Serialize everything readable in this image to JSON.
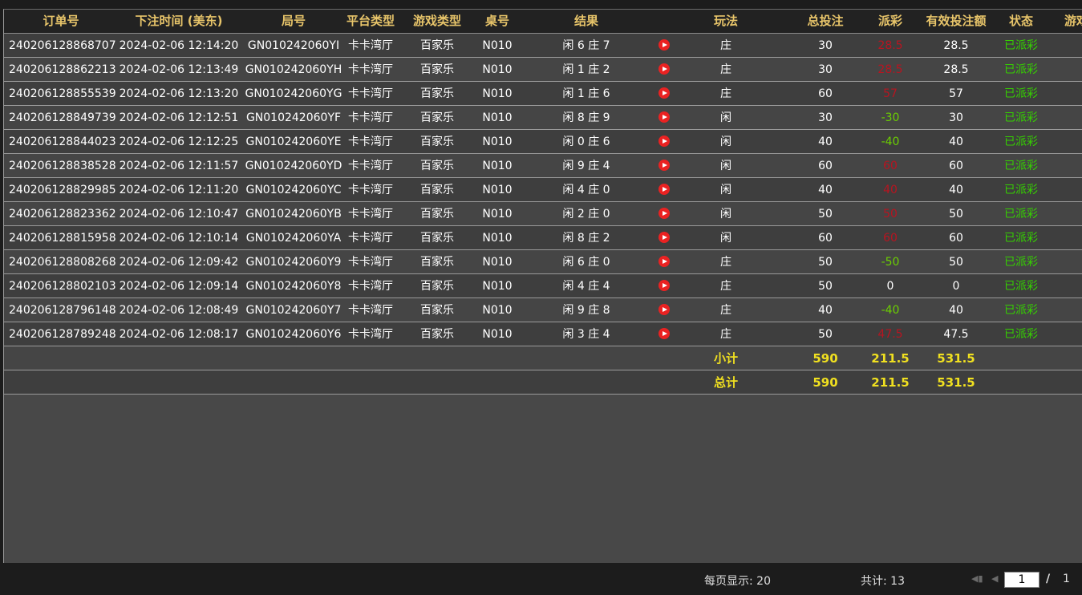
{
  "columns": {
    "order_no": "订单号",
    "bet_time": "下注时间 (美东)",
    "round_no": "局号",
    "platform": "平台类型",
    "game_type": "游戏类型",
    "table_no": "桌号",
    "result": "结果",
    "play": "玩法",
    "total_bet": "总投注",
    "payout": "派彩",
    "valid_bet": "有效投注额",
    "status": "状态",
    "game_more": "游戏"
  },
  "rows": [
    {
      "order": "240206128868707",
      "time": "2024-02-06 12:14:20",
      "round": "GN010242060YI",
      "platform": "卡卡湾厅",
      "game": "百家乐",
      "table": "N010",
      "result": "闲 6 庄 7",
      "play": "庄",
      "bet": "30",
      "payout": "28.5",
      "payout_color": "#b81420",
      "valid": "28.5",
      "status": "已派彩"
    },
    {
      "order": "240206128862213",
      "time": "2024-02-06 12:13:49",
      "round": "GN010242060YH",
      "platform": "卡卡湾厅",
      "game": "百家乐",
      "table": "N010",
      "result": "闲 1 庄 2",
      "play": "庄",
      "bet": "30",
      "payout": "28.5",
      "payout_color": "#b81420",
      "valid": "28.5",
      "status": "已派彩"
    },
    {
      "order": "240206128855539",
      "time": "2024-02-06 12:13:20",
      "round": "GN010242060YG",
      "platform": "卡卡湾厅",
      "game": "百家乐",
      "table": "N010",
      "result": "闲 1 庄 6",
      "play": "庄",
      "bet": "60",
      "payout": "57",
      "payout_color": "#b81420",
      "valid": "57",
      "status": "已派彩"
    },
    {
      "order": "240206128849739",
      "time": "2024-02-06 12:12:51",
      "round": "GN010242060YF",
      "platform": "卡卡湾厅",
      "game": "百家乐",
      "table": "N010",
      "result": "闲 8 庄 9",
      "play": "闲",
      "bet": "30",
      "payout": "-30",
      "payout_color": "#6cd000",
      "valid": "30",
      "status": "已派彩"
    },
    {
      "order": "240206128844023",
      "time": "2024-02-06 12:12:25",
      "round": "GN010242060YE",
      "platform": "卡卡湾厅",
      "game": "百家乐",
      "table": "N010",
      "result": "闲 0 庄 6",
      "play": "闲",
      "bet": "40",
      "payout": "-40",
      "payout_color": "#6cd000",
      "valid": "40",
      "status": "已派彩"
    },
    {
      "order": "240206128838528",
      "time": "2024-02-06 12:11:57",
      "round": "GN010242060YD",
      "platform": "卡卡湾厅",
      "game": "百家乐",
      "table": "N010",
      "result": "闲 9 庄 4",
      "play": "闲",
      "bet": "60",
      "payout": "60",
      "payout_color": "#b81420",
      "valid": "60",
      "status": "已派彩"
    },
    {
      "order": "240206128829985",
      "time": "2024-02-06 12:11:20",
      "round": "GN010242060YC",
      "platform": "卡卡湾厅",
      "game": "百家乐",
      "table": "N010",
      "result": "闲 4 庄 0",
      "play": "闲",
      "bet": "40",
      "payout": "40",
      "payout_color": "#b81420",
      "valid": "40",
      "status": "已派彩"
    },
    {
      "order": "240206128823362",
      "time": "2024-02-06 12:10:47",
      "round": "GN010242060YB",
      "platform": "卡卡湾厅",
      "game": "百家乐",
      "table": "N010",
      "result": "闲 2 庄 0",
      "play": "闲",
      "bet": "50",
      "payout": "50",
      "payout_color": "#b81420",
      "valid": "50",
      "status": "已派彩"
    },
    {
      "order": "240206128815958",
      "time": "2024-02-06 12:10:14",
      "round": "GN010242060YA",
      "platform": "卡卡湾厅",
      "game": "百家乐",
      "table": "N010",
      "result": "闲 8 庄 2",
      "play": "闲",
      "bet": "60",
      "payout": "60",
      "payout_color": "#b81420",
      "valid": "60",
      "status": "已派彩"
    },
    {
      "order": "240206128808268",
      "time": "2024-02-06 12:09:42",
      "round": "GN010242060Y9",
      "platform": "卡卡湾厅",
      "game": "百家乐",
      "table": "N010",
      "result": "闲 6 庄 0",
      "play": "庄",
      "bet": "50",
      "payout": "-50",
      "payout_color": "#6cd000",
      "valid": "50",
      "status": "已派彩"
    },
    {
      "order": "240206128802103",
      "time": "2024-02-06 12:09:14",
      "round": "GN010242060Y8",
      "platform": "卡卡湾厅",
      "game": "百家乐",
      "table": "N010",
      "result": "闲 4 庄 4",
      "play": "庄",
      "bet": "50",
      "payout": "0",
      "payout_color": "#ffffff",
      "valid": "0",
      "status": "已派彩"
    },
    {
      "order": "240206128796148",
      "time": "2024-02-06 12:08:49",
      "round": "GN010242060Y7",
      "platform": "卡卡湾厅",
      "game": "百家乐",
      "table": "N010",
      "result": "闲 9 庄 8",
      "play": "庄",
      "bet": "40",
      "payout": "-40",
      "payout_color": "#6cd000",
      "valid": "40",
      "status": "已派彩"
    },
    {
      "order": "240206128789248",
      "time": "2024-02-06 12:08:17",
      "round": "GN010242060Y6",
      "platform": "卡卡湾厅",
      "game": "百家乐",
      "table": "N010",
      "result": "闲 3 庄 4",
      "play": "庄",
      "bet": "50",
      "payout": "47.5",
      "payout_color": "#b81420",
      "valid": "47.5",
      "status": "已派彩"
    }
  ],
  "subtotal": {
    "label": "小计",
    "bet": "590",
    "payout": "211.5",
    "valid": "531.5"
  },
  "total": {
    "label": "总计",
    "bet": "590",
    "payout": "211.5",
    "valid": "531.5"
  },
  "footer": {
    "page_size": "每页显示: 20",
    "count": "共计: 13",
    "current_page": "1",
    "separator": "/",
    "total_pages": "1"
  },
  "icons": {
    "replay": "play-video-icon",
    "first": "first-page-icon",
    "prev": "prev-page-icon"
  }
}
